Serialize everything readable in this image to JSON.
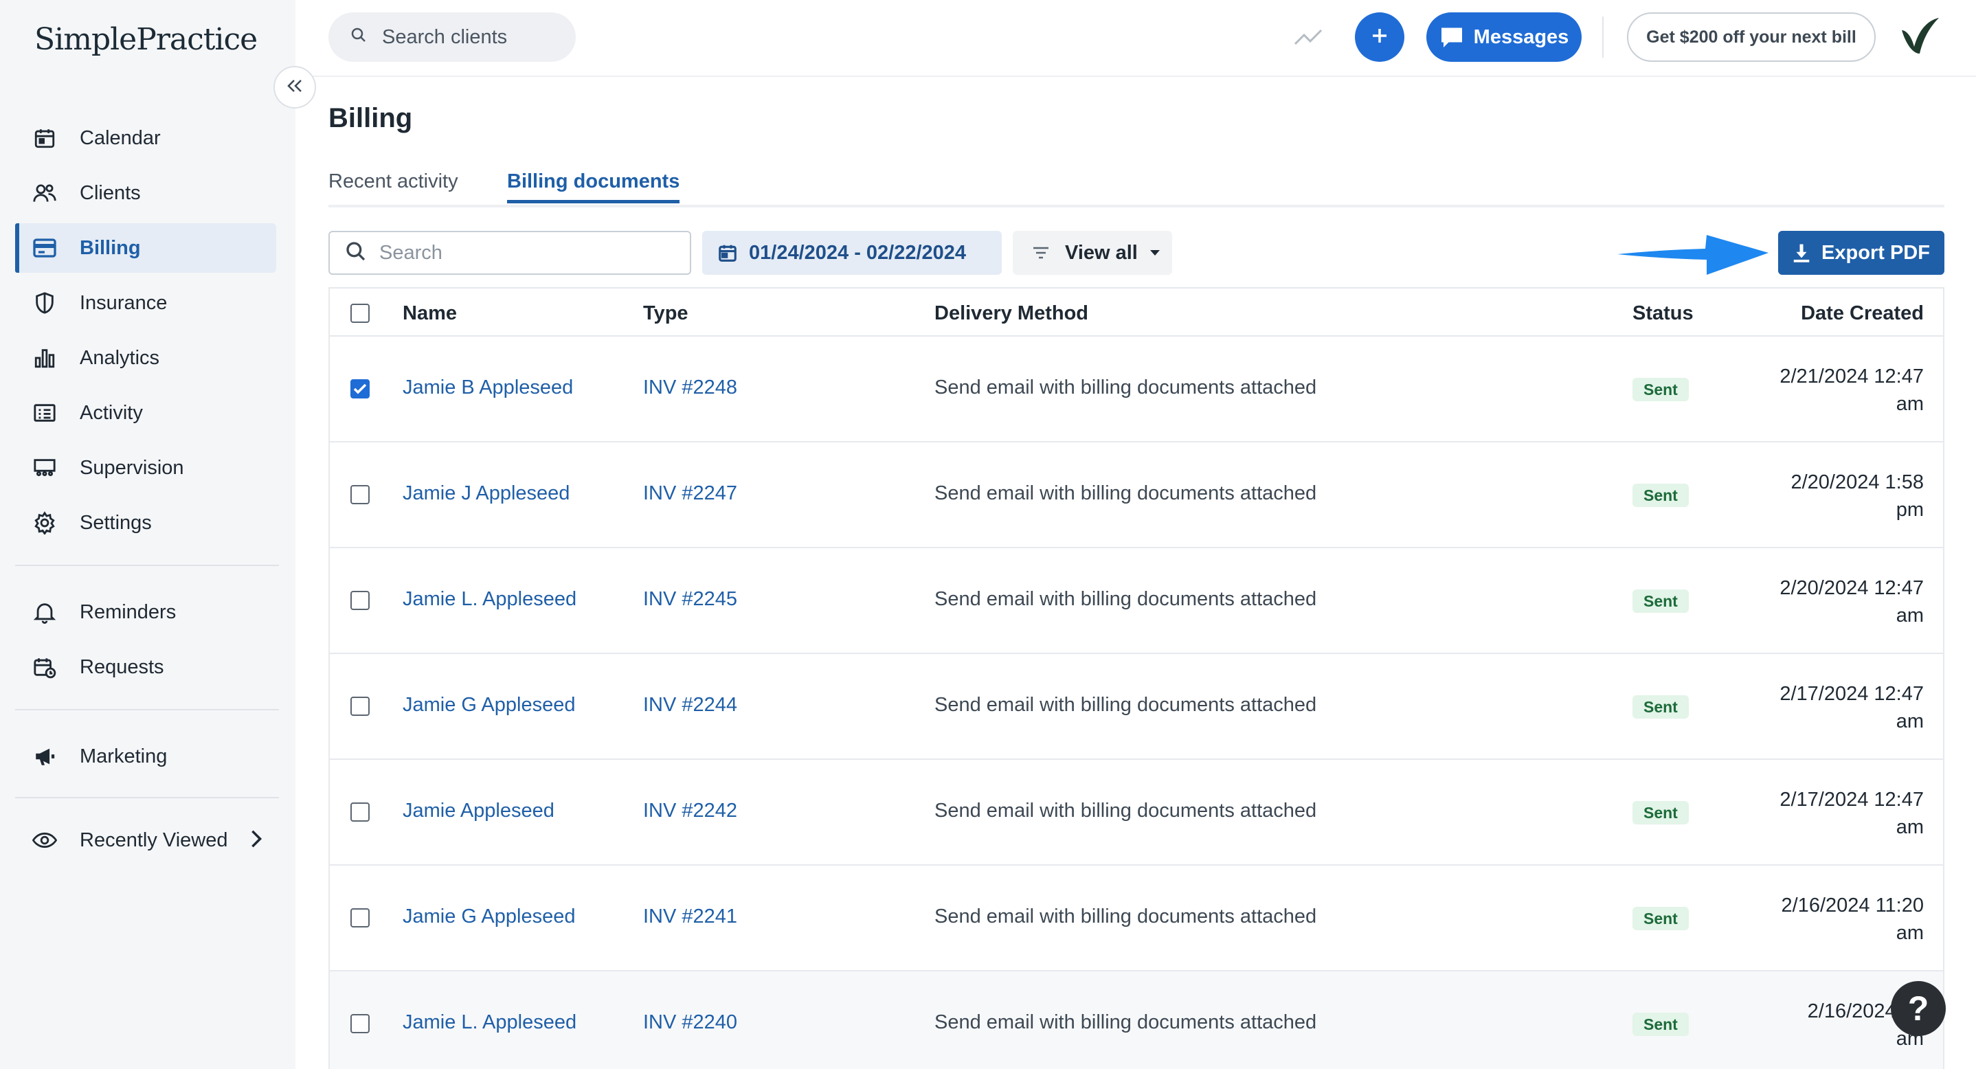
{
  "app": {
    "logo": "SimplePractice"
  },
  "sidebar": {
    "items": [
      {
        "label": "Calendar",
        "icon": "calendar-icon"
      },
      {
        "label": "Clients",
        "icon": "users-icon"
      },
      {
        "label": "Billing",
        "icon": "credit-card-icon",
        "active": true
      },
      {
        "label": "Insurance",
        "icon": "shield-icon"
      },
      {
        "label": "Analytics",
        "icon": "bar-chart-icon"
      },
      {
        "label": "Activity",
        "icon": "list-icon"
      },
      {
        "label": "Supervision",
        "icon": "supervision-icon"
      },
      {
        "label": "Settings",
        "icon": "gear-icon"
      }
    ],
    "secondary": [
      {
        "label": "Reminders",
        "icon": "bell-icon"
      },
      {
        "label": "Requests",
        "icon": "calendar-request-icon"
      }
    ],
    "marketing": {
      "label": "Marketing",
      "icon": "megaphone-icon"
    },
    "recently_viewed": {
      "label": "Recently Viewed",
      "icon": "eye-icon"
    }
  },
  "topbar": {
    "search_placeholder": "Search clients",
    "messages_label": "Messages",
    "offer_label": "Get $200 off your next bill"
  },
  "page": {
    "title": "Billing",
    "tabs": [
      {
        "label": "Recent activity",
        "active": false
      },
      {
        "label": "Billing documents",
        "active": true
      }
    ]
  },
  "filters": {
    "search_placeholder": "Search",
    "date_range": "01/24/2024 - 02/22/2024",
    "view_label": "View all",
    "export_label": "Export PDF"
  },
  "table": {
    "columns": [
      "Name",
      "Type",
      "Delivery Method",
      "Status",
      "Date Created"
    ],
    "rows": [
      {
        "checked": true,
        "name": "Jamie B Appleseed",
        "type": "INV #2248",
        "delivery": "Send email with billing documents attached",
        "status": "Sent",
        "date1": "2/21/2024 12:47",
        "date2": "am"
      },
      {
        "checked": false,
        "name": "Jamie J Appleseed",
        "type": "INV #2247",
        "delivery": "Send email with billing documents attached",
        "status": "Sent",
        "date1": "2/20/2024 1:58",
        "date2": "pm"
      },
      {
        "checked": false,
        "name": "Jamie L. Appleseed",
        "type": "INV #2245",
        "delivery": "Send email with billing documents attached",
        "status": "Sent",
        "date1": "2/20/2024 12:47",
        "date2": "am"
      },
      {
        "checked": false,
        "name": "Jamie G Appleseed",
        "type": "INV #2244",
        "delivery": "Send email with billing documents attached",
        "status": "Sent",
        "date1": "2/17/2024 12:47",
        "date2": "am"
      },
      {
        "checked": false,
        "name": "Jamie Appleseed",
        "type": "INV #2242",
        "delivery": "Send email with billing documents attached",
        "status": "Sent",
        "date1": "2/17/2024 12:47",
        "date2": "am"
      },
      {
        "checked": false,
        "name": "Jamie G Appleseed",
        "type": "INV #2241",
        "delivery": "Send email with billing documents attached",
        "status": "Sent",
        "date1": "2/16/2024 11:20",
        "date2": "am"
      },
      {
        "checked": false,
        "name": "Jamie L. Appleseed",
        "type": "INV #2240",
        "delivery": "Send email with billing documents attached",
        "status": "Sent",
        "date1": "2/16/2024 12",
        "date2": "am"
      }
    ]
  },
  "help": {
    "label": "?"
  },
  "colors": {
    "accent": "#1f5fa8",
    "primary_button": "#1f6cd6",
    "sent_badge_bg": "#e3f4e8",
    "sent_badge_text": "#1c6b3a",
    "annotation_arrow": "#1e88f0"
  }
}
